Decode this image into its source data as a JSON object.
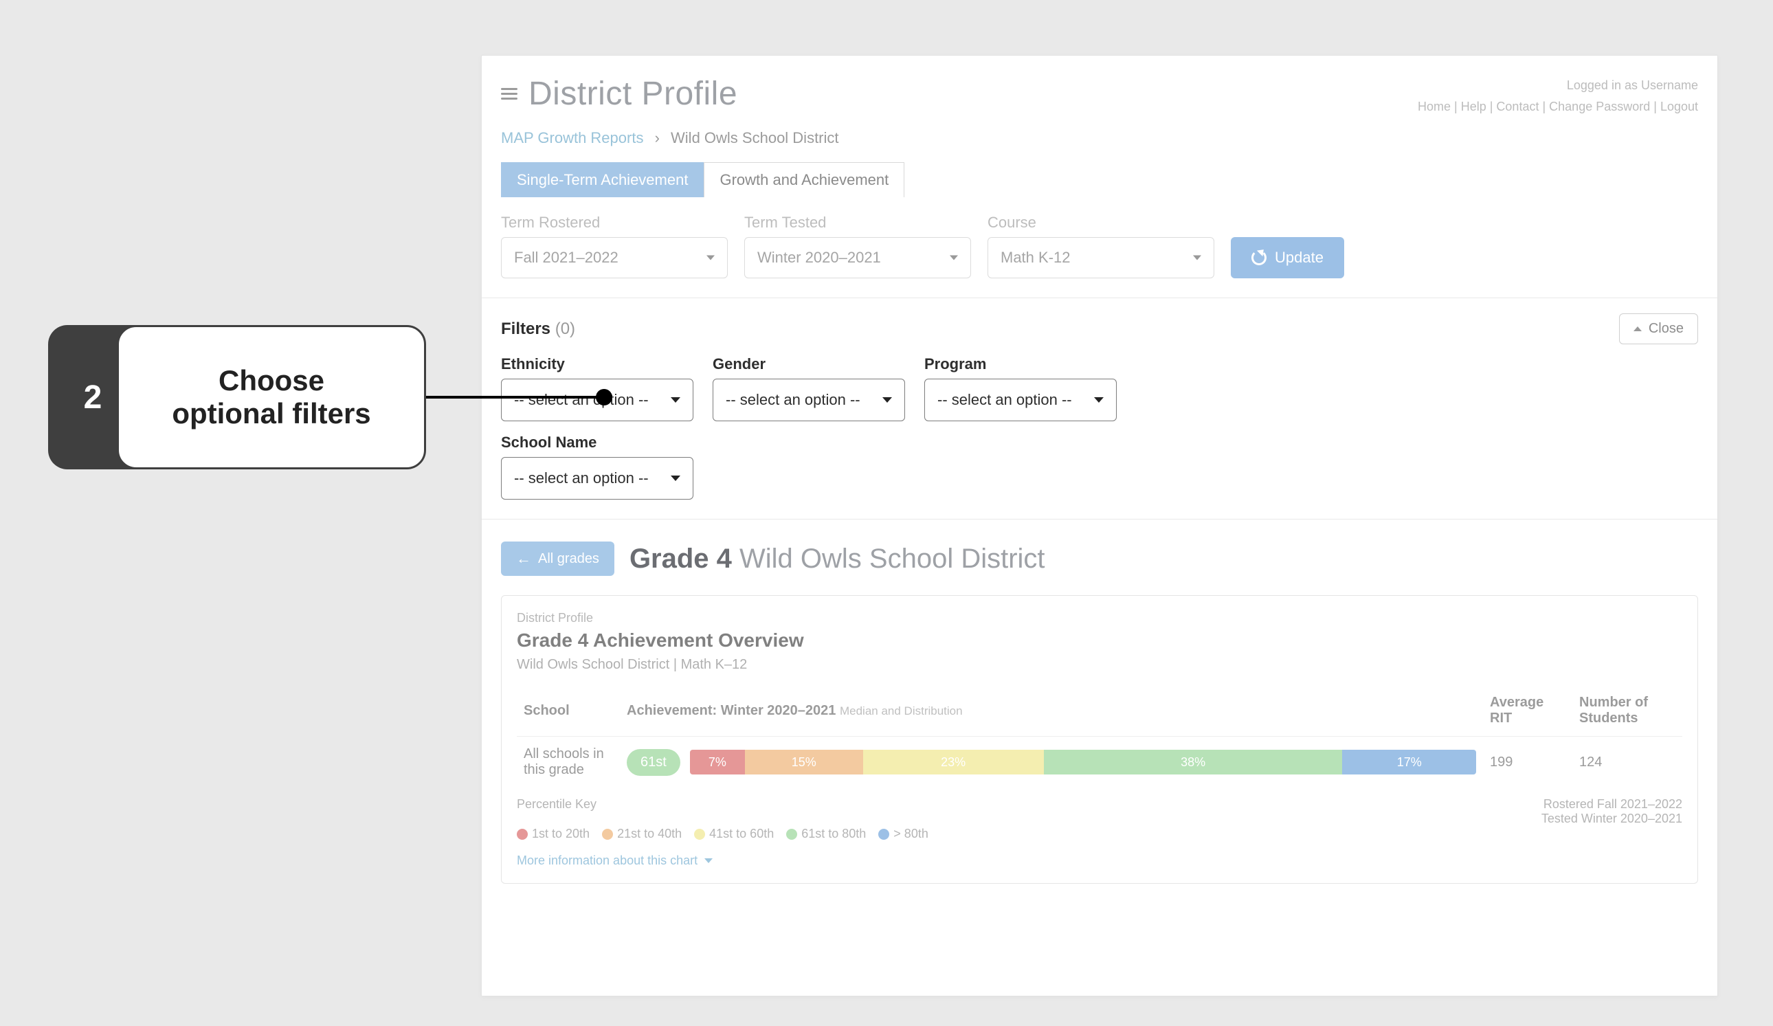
{
  "header": {
    "title": "District Profile",
    "logged_in": "Logged in as Username",
    "links": {
      "home": "Home",
      "help": "Help",
      "contact": "Contact",
      "change_pw": "Change Password",
      "logout": "Logout"
    }
  },
  "crumbs": {
    "root": "MAP Growth Reports",
    "current": "Wild Owls School District"
  },
  "tabs": {
    "active": "Single-Term Achievement",
    "other": "Growth and Achievement"
  },
  "term": {
    "rostered_label": "Term Rostered",
    "rostered_value": "Fall 2021–2022",
    "tested_label": "Term Tested",
    "tested_value": "Winter 2020–2021",
    "course_label": "Course",
    "course_value": "Math K-12",
    "update": "Update"
  },
  "filters": {
    "label": "Filters",
    "count": "(0)",
    "close": "Close",
    "ethnicity": "Ethnicity",
    "gender": "Gender",
    "program": "Program",
    "school": "School Name",
    "placeholder": "-- select an option --"
  },
  "back": "All grades",
  "grade": {
    "strong": "Grade 4",
    "rest": "Wild Owls School District"
  },
  "card": {
    "sup": "District Profile",
    "title": "Grade 4 Achievement Overview",
    "sub": "Wild Owls School District  |  Math K–12",
    "th_school": "School",
    "th_ach": "Achievement: Winter 2020–2021",
    "th_ach_sub": "Median and Distribution",
    "th_rit": "Average RIT",
    "th_num": "Number of Students",
    "row_school": "All schools in this grade",
    "row_median": "61st",
    "row_rit": "199",
    "row_num": "124"
  },
  "chart_data": {
    "type": "bar",
    "categories": [
      "1st to 20th",
      "21st to 40th",
      "41st to 60th",
      "61st to 80th",
      "> 80th"
    ],
    "values": [
      7,
      15,
      23,
      38,
      17
    ],
    "colors": [
      "#e59797",
      "#f3caa0",
      "#f4eeb0",
      "#b7e2b7",
      "#9cc0e6"
    ],
    "title": "Achievement Distribution"
  },
  "leg": {
    "head": "Percentile Key",
    "items": [
      "1st to 20th",
      "21st to 40th",
      "41st to 60th",
      "61st to 80th",
      "> 80th"
    ],
    "roster": "Rostered Fall 2021–2022",
    "tested": "Tested Winter 2020–2021"
  },
  "more": "More information about this chart",
  "callout": {
    "num": "2",
    "text1": "Choose",
    "text2": "optional filters"
  }
}
